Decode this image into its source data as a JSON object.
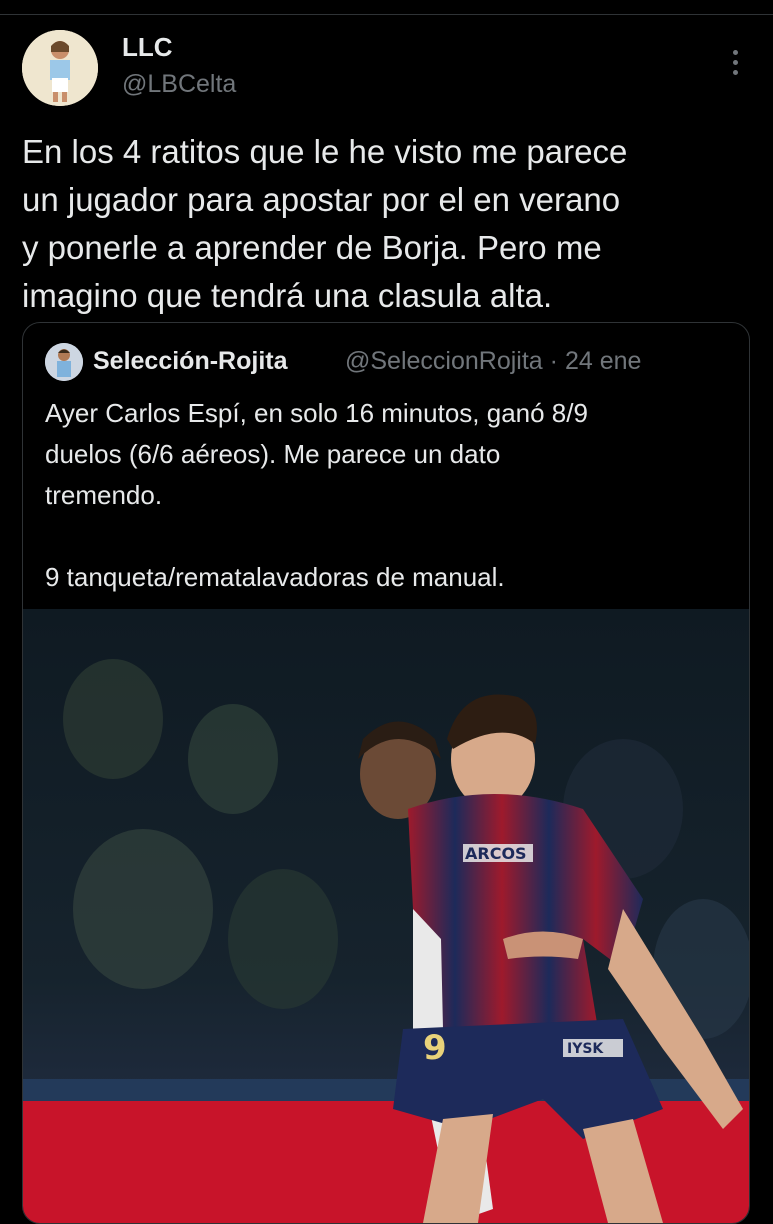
{
  "tweet": {
    "author_name": "LLC",
    "author_handle": "@LBCelta",
    "text": "En los 4 ratitos que le he visto me parece\nun jugador para apostar por el en verano\ny ponerle a aprender de Borja. Pero me\nimagino que tendrá una clasula alta."
  },
  "quoted": {
    "author_name": "Selección-Rojita",
    "author_handle": "@SeleccionRojita",
    "separator": "·",
    "date": "24 ene",
    "text": "Ayer Carlos Espí, en solo 16 minutos, ganó 8/9\nduelos (6/6 aéreos). Me parece un dato\ntremendo.\n\n9 tanqueta/rematalavadoras de manual.",
    "photo": {
      "jersey_texts": [
        "ARCOS",
        "IYSK",
        "9"
      ]
    }
  },
  "icons": {
    "more": "more-dots-vertical-icon"
  },
  "colors": {
    "background": "#000000",
    "text_primary": "#e7e9ea",
    "text_secondary": "#71767b",
    "border": "#2f3336"
  }
}
